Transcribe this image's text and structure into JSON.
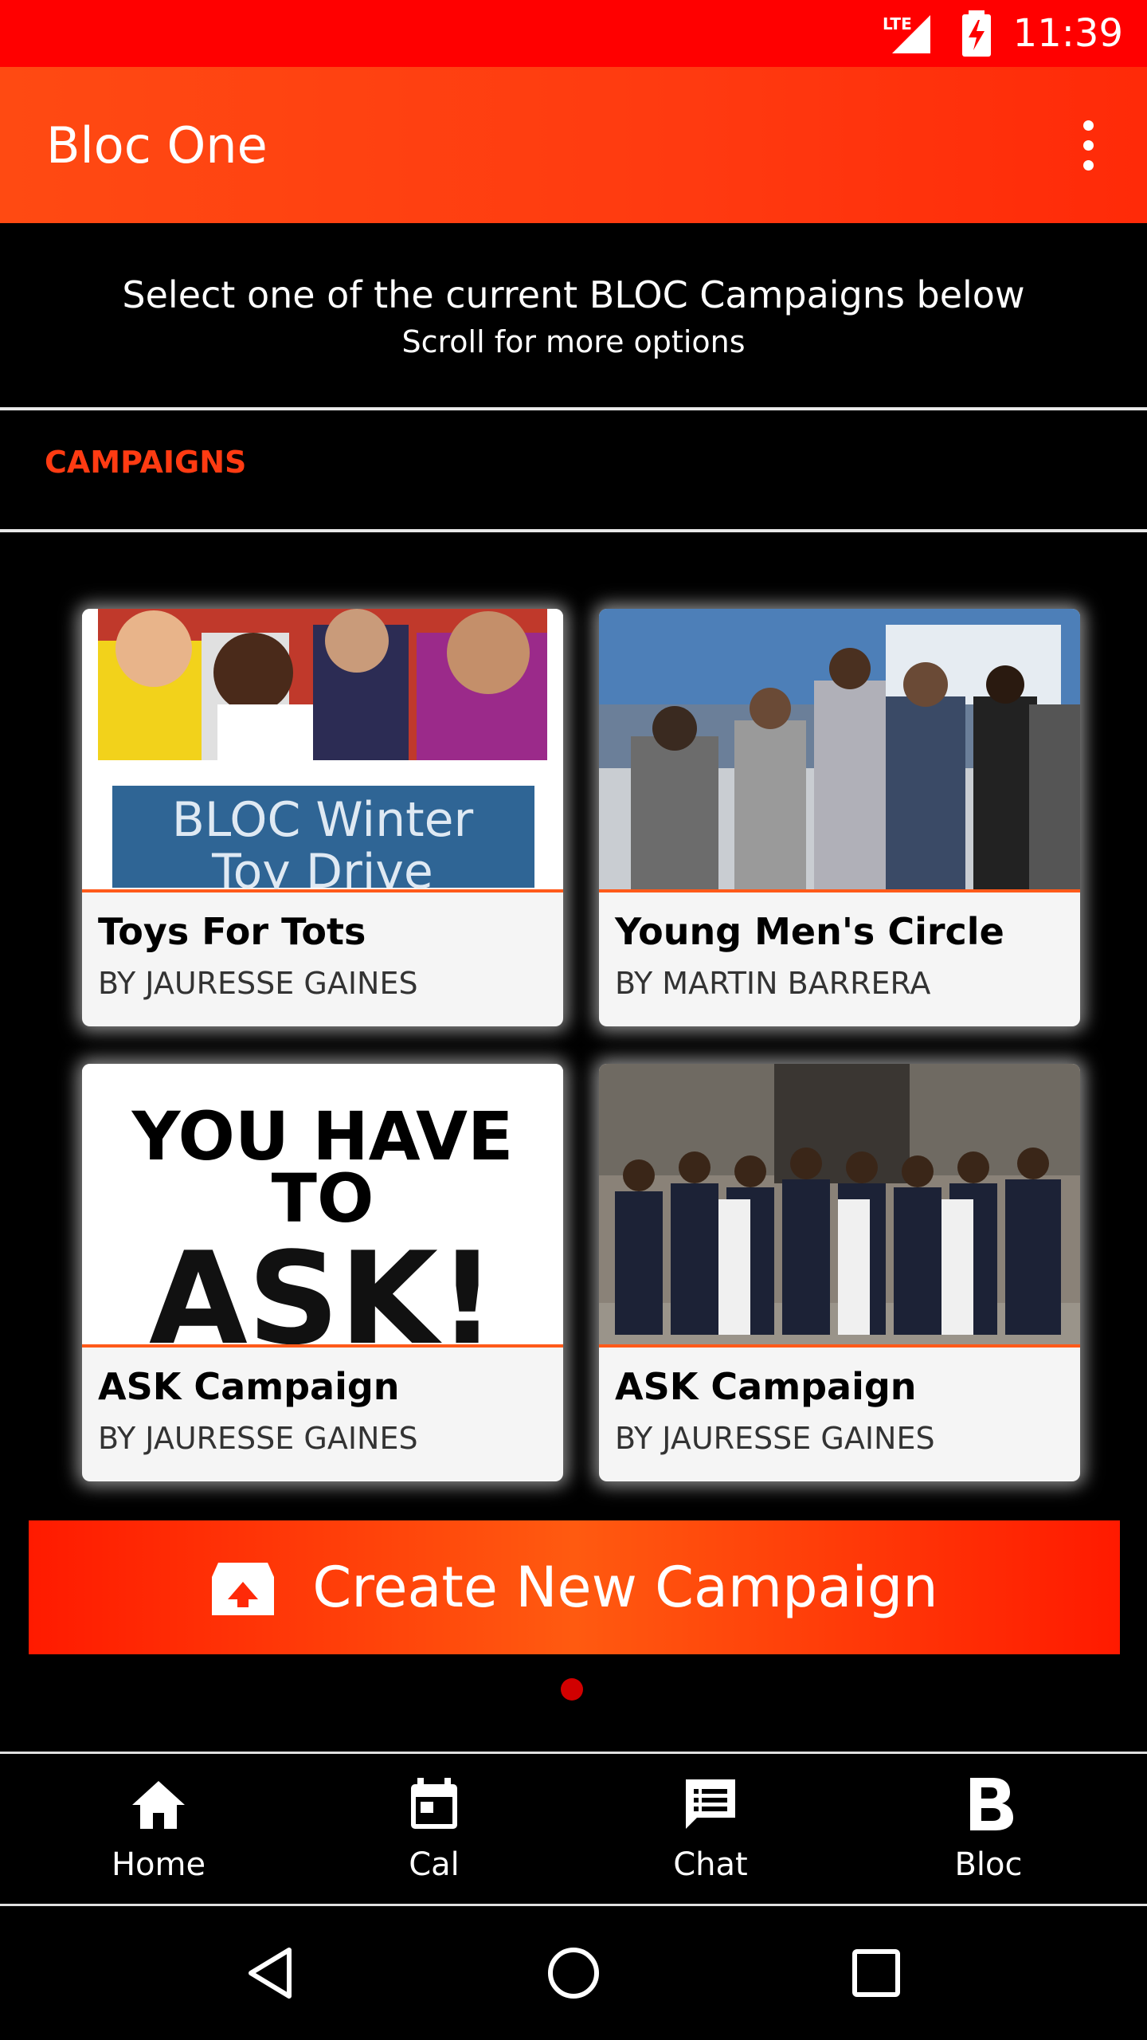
{
  "status_bar": {
    "network": "LTE",
    "time": "11:39"
  },
  "app_bar": {
    "title": "Bloc One",
    "menu_icon": "more-vert-icon"
  },
  "instructions": {
    "line1": "Select one of the current BLOC Campaigns below",
    "line2": "Scroll for more options"
  },
  "section": {
    "label": "CAMPAIGNS"
  },
  "campaigns": [
    {
      "title": "Toys For Tots",
      "author": "BY JAURESSE GAINES",
      "image_banner_line1": "BLOC Winter",
      "image_banner_line2": "Toy Drive"
    },
    {
      "title": "Young Men's Circle",
      "author": "BY MARTIN BARRERA"
    },
    {
      "title": "ASK Campaign",
      "author": "BY JAURESSE GAINES",
      "image_text_line1": "YOU HAVE",
      "image_text_line2": "TO",
      "image_text_line3": "ASK!"
    },
    {
      "title": "ASK Campaign",
      "author": "BY JAURESSE GAINES"
    }
  ],
  "create_button": {
    "label": "Create New Campaign",
    "icon": "upload-box-icon"
  },
  "pager": {
    "current_page": 1,
    "total_pages": 1
  },
  "bottom_nav": [
    {
      "label": "Home",
      "icon": "home-icon"
    },
    {
      "label": "Cal",
      "icon": "calendar-icon"
    },
    {
      "label": "Chat",
      "icon": "chat-icon"
    },
    {
      "label": "Bloc",
      "icon": "bloc-logo-icon"
    }
  ],
  "colors": {
    "status_bar": "#ff0000",
    "app_bar": "#ff3a10",
    "accent": "#ff3b12",
    "background": "#000000",
    "card_bg": "#f5f5f5"
  }
}
